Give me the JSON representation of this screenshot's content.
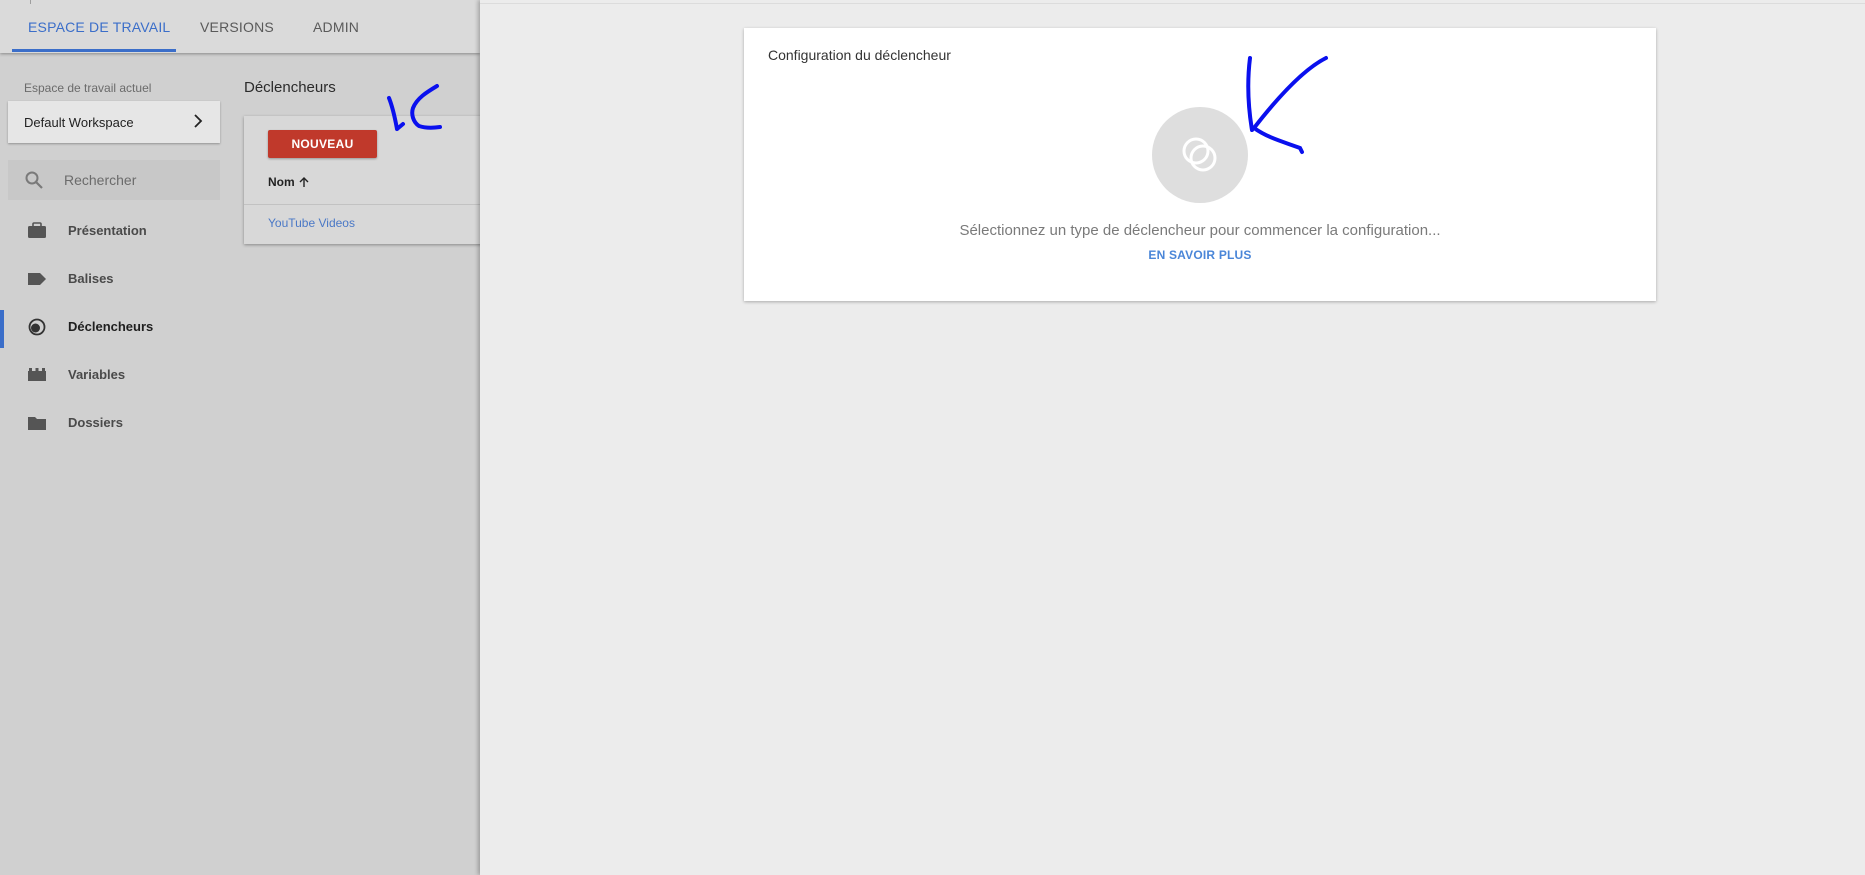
{
  "top_nav": {
    "tabs": [
      {
        "label": "ESPACE DE TRAVAIL"
      },
      {
        "label": "VERSIONS"
      },
      {
        "label": "ADMIN"
      }
    ]
  },
  "workspace": {
    "label": "Espace de travail actuel",
    "name": "Default Workspace"
  },
  "search": {
    "placeholder": "Rechercher"
  },
  "sidebar": {
    "items": [
      {
        "label": "Présentation",
        "icon": "briefcase-icon"
      },
      {
        "label": "Balises",
        "icon": "tag-icon"
      },
      {
        "label": "Déclencheurs",
        "icon": "trigger-icon",
        "active": true
      },
      {
        "label": "Variables",
        "icon": "variables-icon"
      },
      {
        "label": "Dossiers",
        "icon": "folder-icon"
      }
    ]
  },
  "list": {
    "title": "Déclencheurs",
    "new_button": "NOUVEAU",
    "column_header": "Nom",
    "rows": [
      {
        "name": "YouTube Videos"
      }
    ]
  },
  "panel": {
    "title": "Configuration du déclencheur",
    "hint": "Sélectionnez un type de déclencheur pour commencer la configuration...",
    "learn_more": "EN SAVOIR PLUS"
  },
  "colors": {
    "accent_blue": "#3b6ec9",
    "new_button_red": "#c0392b",
    "link_blue": "#4a78c6",
    "annotation_blue": "#0a10ee"
  }
}
